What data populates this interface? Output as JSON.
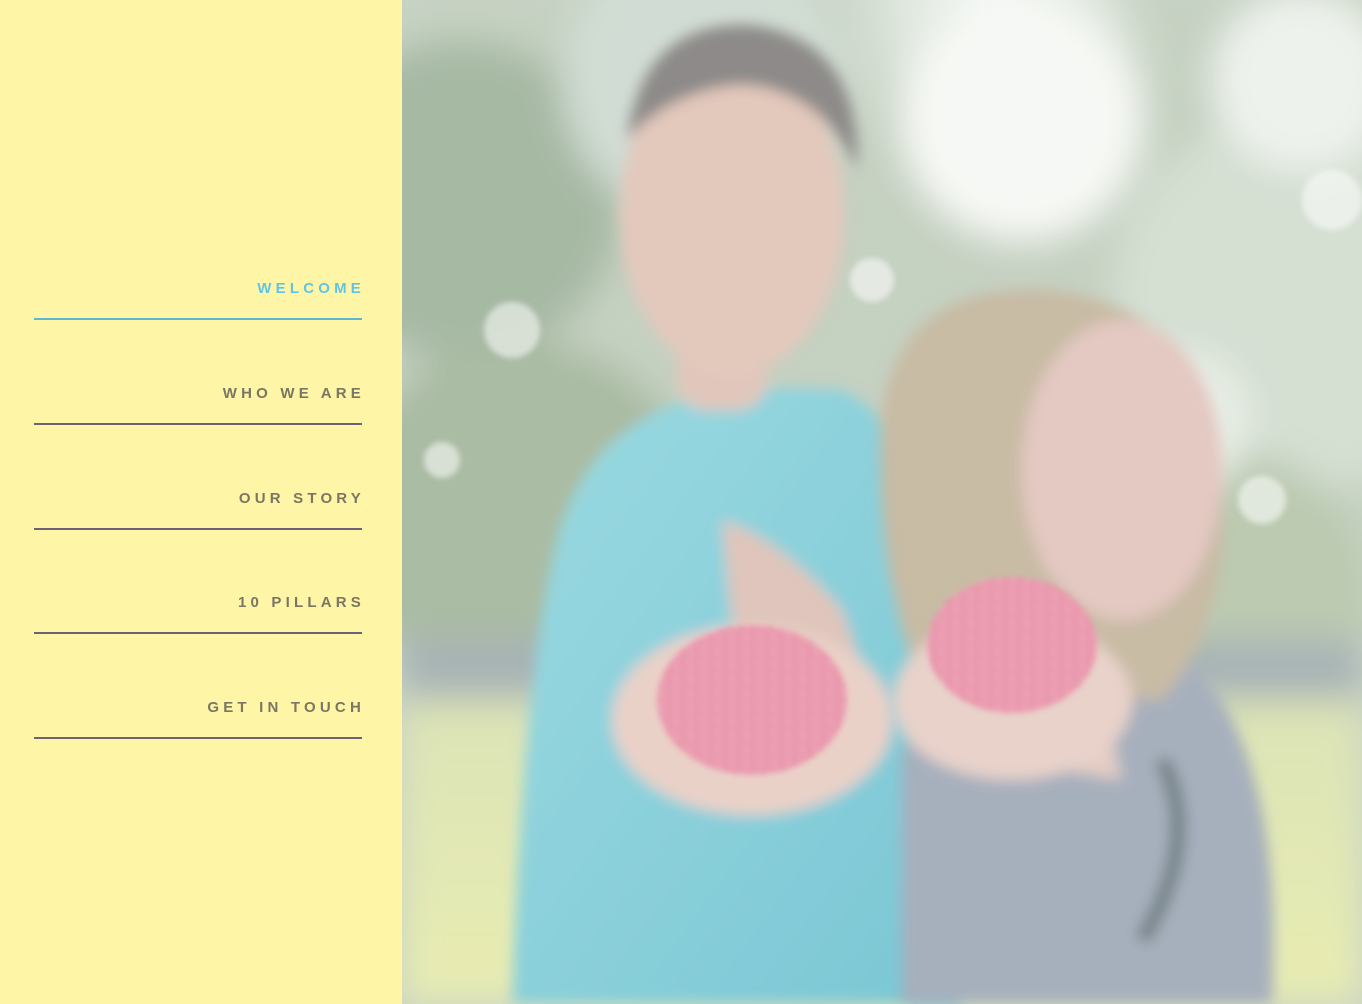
{
  "nav": {
    "items": [
      {
        "label": "WELCOME",
        "active": true
      },
      {
        "label": "WHO WE ARE",
        "active": false
      },
      {
        "label": "OUR STORY",
        "active": false
      },
      {
        "label": "10 PILLARS",
        "active": false
      },
      {
        "label": "GET IN TOUCH",
        "active": false
      }
    ]
  },
  "colors": {
    "sidebar_bg": "#fef5a6",
    "nav_text": "#7b7663",
    "nav_active": "#62c4e4",
    "nav_rule": "#6b6375"
  },
  "hero": {
    "icon": "hero-photo"
  }
}
